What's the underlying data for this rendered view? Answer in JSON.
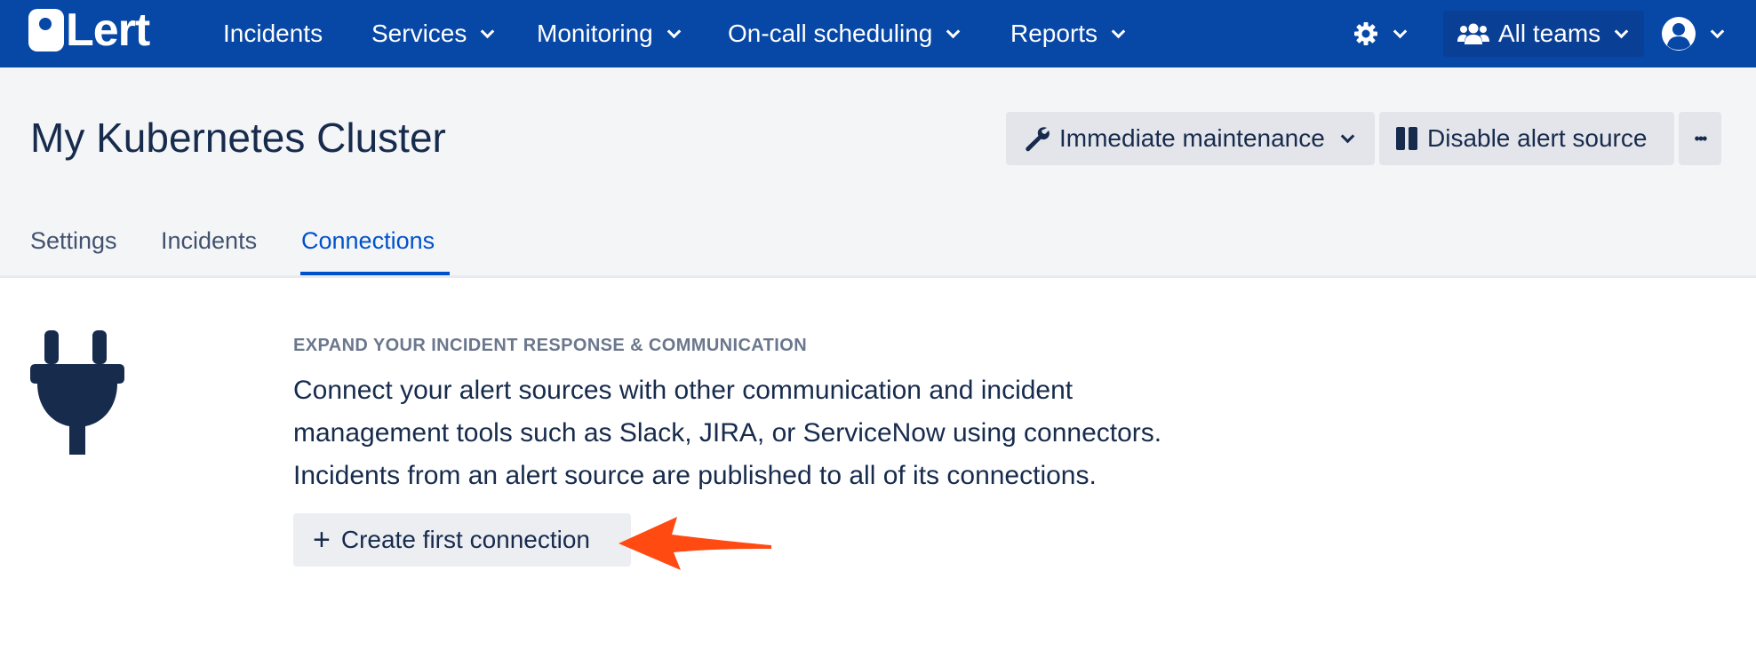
{
  "nav": {
    "logo_text": "Lert",
    "items": [
      {
        "label": "Incidents"
      },
      {
        "label": "Services"
      },
      {
        "label": "Monitoring"
      },
      {
        "label": "On-call scheduling"
      },
      {
        "label": "Reports"
      }
    ],
    "teams_label": "All teams"
  },
  "page": {
    "title": "My Kubernetes Cluster",
    "maintenance_label": "Immediate maintenance",
    "disable_label": "Disable alert source",
    "more_label": "•••"
  },
  "tabs": [
    {
      "label": "Settings"
    },
    {
      "label": "Incidents"
    },
    {
      "label": "Connections",
      "active": true
    }
  ],
  "content": {
    "eyebrow": "EXPAND YOUR INCIDENT RESPONSE & COMMUNICATION",
    "description_lines": [
      "Connect your alert sources with other communication and incident",
      "management tools such as Slack, JIRA, or ServiceNow using connectors.",
      "Incidents from an alert source are published to all of its connections."
    ],
    "create_button_label": "Create first connection",
    "create_button_icon": "+"
  },
  "colors": {
    "nav_bg": "#0747a6",
    "accent": "#0052cc",
    "annotation_arrow": "#ff4a12"
  },
  "icons": [
    "logo-icon",
    "gear-icon",
    "team-icon",
    "user-avatar-icon",
    "wrench-icon",
    "pause-icon",
    "more-icon",
    "plug-icon",
    "plus-icon",
    "annotation-arrow"
  ]
}
